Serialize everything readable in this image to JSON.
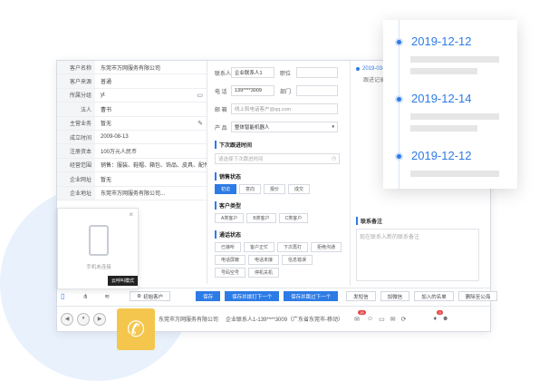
{
  "customer_fields": [
    {
      "label": "客户名称",
      "value": "东莞市万网服务有限公司",
      "icon": ""
    },
    {
      "label": "客户来源",
      "value": "普通",
      "icon": ""
    },
    {
      "label": "所属分组",
      "value": "yt",
      "icon": "folder-icon"
    },
    {
      "label": "法人",
      "value": "曹书",
      "icon": ""
    },
    {
      "label": "主营业务",
      "value": "暂无",
      "icon": "pencil-icon"
    },
    {
      "label": "成立时间",
      "value": "2009-08-13",
      "icon": ""
    },
    {
      "label": "注册资本",
      "value": "100万元人民币",
      "icon": ""
    },
    {
      "label": "经营范围",
      "value": "销售：服装、鞋帽、箱包、饰品、皮具、配件、...",
      "icon": ""
    },
    {
      "label": "企业网址",
      "value": "暂无",
      "icon": ""
    },
    {
      "label": "企业地址",
      "value": "东莞市万网服务有限公司...",
      "icon": ""
    }
  ],
  "contact": {
    "name_label": "联系人",
    "name_value": "企业联系人1",
    "title_label": "职位",
    "title_value": "",
    "phone_label": "电 话",
    "phone_value": "139****3009",
    "dept_label": "部门",
    "dept_value": "",
    "email_label": "邮 箱",
    "email_value": "线上和电话客户@qq.com",
    "product_label": "产 品",
    "product_value": "整体智能机器人"
  },
  "next_followup": {
    "title": "下次跟进时间",
    "placeholder": "请选择下次跟进时间"
  },
  "sales_status": {
    "title": "销售状态",
    "options": [
      "初访",
      "意向",
      "报价",
      "成交"
    ],
    "active": 0
  },
  "customer_type": {
    "title": "客户类型",
    "options": [
      "A类客户",
      "B类客户",
      "C类客户"
    ]
  },
  "call_status": {
    "title": "通话状态",
    "options": [
      "已接听",
      "客户正忙",
      "下次再打",
      "拒绝沟通",
      "电话屏蔽",
      "电话未接",
      "信息错误",
      "号码空号",
      "停机关机"
    ]
  },
  "right_panel": {
    "log_date": "2019-03-...",
    "log_text": "跟进记录...",
    "notes_title": "联系备注",
    "notes_placeholder": "现在联系入新的联系备注"
  },
  "popup": {
    "status": "手机未连接",
    "tooltip": "云呼叫模式"
  },
  "bottom_buttons": {
    "initial": "初始客户",
    "save": "保存",
    "save_next": "保存并拨打下一个",
    "save_stay": "保存并跳过下一个",
    "send_sms": "发短信",
    "add_friend": "加微信",
    "blacklist": "加入的名单",
    "delete": "删除至公海"
  },
  "call_bar": {
    "company": "东莞市万网服务有限公司",
    "contact": "企业联系人1-139****3009（广东省东莞市-移动）",
    "badge1": "19",
    "badge2": "9"
  },
  "timeline": {
    "dates": [
      "2019-12-12",
      "2019-12-14",
      "2019-12-12"
    ]
  },
  "colors": {
    "accent": "#2d7be5",
    "phone_yellow": "#f4c64d"
  }
}
